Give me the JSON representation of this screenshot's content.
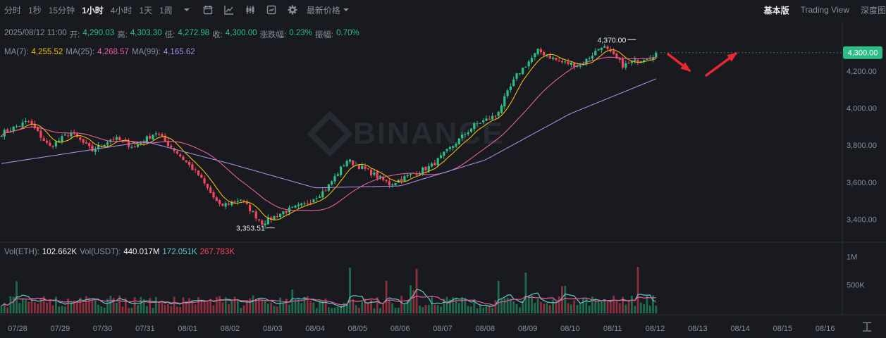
{
  "toolbar": {
    "intervals": [
      "分时",
      "1秒",
      "15分钟",
      "1小时",
      "4小时",
      "1天",
      "1周"
    ],
    "active_interval": "1小时",
    "price_mode": "最新价格",
    "views": [
      "基本版",
      "Trading View",
      "深度图"
    ],
    "active_view": "基本版"
  },
  "candle_info": {
    "datetime": "2025/08/12 11:00",
    "open_label": "开:",
    "open": "4,290.03",
    "high_label": "高:",
    "high": "4,303.30",
    "low_label": "低:",
    "low": "4,272.98",
    "close_label": "收:",
    "close": "4,300.00",
    "change_label": "涨跌幅:",
    "change": "0.23%",
    "amplitude_label": "振幅:",
    "amplitude": "0.70%"
  },
  "ma_info": {
    "ma7_label": "MA(7):",
    "ma7": "4,255.52",
    "ma25_label": "MA(25):",
    "ma25": "4,268.57",
    "ma99_label": "MA(99):",
    "ma99": "4,165.62"
  },
  "vol_info": {
    "vol_eth_label": "Vol(ETH):",
    "vol_eth": "102.662K",
    "vol_usdt_label": "Vol(USDT):",
    "vol_usdt": "440.017M",
    "ma_a": "172.051K",
    "ma_b": "267.783K"
  },
  "watermark": "BINANCE",
  "colors": {
    "up": "#2ebd85",
    "down": "#f6465d",
    "ma7": "#f0b90b",
    "ma25": "#e85d9a",
    "ma99": "#a88bde",
    "vol_ma_a": "#5fc9c9",
    "vol_ma_b": "#e85d9a",
    "arrow": "#e8272f",
    "background": "#181a20"
  },
  "chart_data": {
    "type": "candlestick",
    "interval": "1h",
    "x_tick_labels": [
      "07/28",
      "07/29",
      "07/30",
      "07/31",
      "08/01",
      "08/02",
      "08/03",
      "08/04",
      "08/05",
      "08/06",
      "08/07",
      "08/08",
      "08/09",
      "08/10",
      "08/11",
      "08/12",
      "08/13",
      "08/14",
      "08/15",
      "08/16"
    ],
    "price_axis_labels": [
      "4,200.00",
      "4,000.00",
      "3,800.00",
      "3,600.00",
      "3,400.00"
    ],
    "price_axis_values": [
      4200,
      4000,
      3800,
      3600,
      3400
    ],
    "price_range": [
      3280,
      4470
    ],
    "current_price": 4300,
    "current_price_label": "4,300.00",
    "high_marker": {
      "value": 4370,
      "label": "4,370.00",
      "date": "08/11"
    },
    "low_marker": {
      "value": 3353.51,
      "label": "3,353.51",
      "date": "08/03"
    },
    "volume_axis_labels": [
      "1M",
      "500K"
    ],
    "volume_axis_values": [
      1000000,
      500000
    ],
    "volume_range": [
      0,
      1180000
    ],
    "price_key_points": [
      {
        "date": "07/28",
        "close": 3860
      },
      {
        "date": "07/28",
        "close": 3930
      },
      {
        "date": "07/29",
        "close": 3790
      },
      {
        "date": "07/29",
        "close": 3870
      },
      {
        "date": "07/30",
        "close": 3770
      },
      {
        "date": "07/30",
        "close": 3840
      },
      {
        "date": "07/31",
        "close": 3790
      },
      {
        "date": "07/31",
        "close": 3870
      },
      {
        "date": "08/01",
        "close": 3760
      },
      {
        "date": "08/01",
        "close": 3640
      },
      {
        "date": "08/02",
        "close": 3470
      },
      {
        "date": "08/02",
        "close": 3510
      },
      {
        "date": "08/03",
        "close": 3380
      },
      {
        "date": "08/03",
        "close": 3440
      },
      {
        "date": "08/04",
        "close": 3480
      },
      {
        "date": "08/04",
        "close": 3560
      },
      {
        "date": "08/05",
        "close": 3720
      },
      {
        "date": "08/05",
        "close": 3660
      },
      {
        "date": "08/06",
        "close": 3590
      },
      {
        "date": "08/06",
        "close": 3640
      },
      {
        "date": "08/07",
        "close": 3690
      },
      {
        "date": "08/07",
        "close": 3800
      },
      {
        "date": "08/08",
        "close": 3910
      },
      {
        "date": "08/08",
        "close": 3960
      },
      {
        "date": "08/09",
        "close": 4180
      },
      {
        "date": "08/09",
        "close": 4310
      },
      {
        "date": "08/10",
        "close": 4250
      },
      {
        "date": "08/10",
        "close": 4230
      },
      {
        "date": "08/11",
        "close": 4340
      },
      {
        "date": "08/11",
        "close": 4230
      },
      {
        "date": "08/12",
        "close": 4300
      }
    ],
    "ma99_key_points": [
      {
        "date": "07/28",
        "value": 3700
      },
      {
        "date": "07/31",
        "value": 3820
      },
      {
        "date": "08/02",
        "value": 3700
      },
      {
        "date": "08/04",
        "value": 3570
      },
      {
        "date": "08/06",
        "value": 3580
      },
      {
        "date": "08/08",
        "value": 3720
      },
      {
        "date": "08/10",
        "value": 3970
      },
      {
        "date": "08/12",
        "value": 4165
      }
    ],
    "series": [
      {
        "name": "MA(7)",
        "last": 4255.52
      },
      {
        "name": "MA(25)",
        "last": 4268.57
      },
      {
        "name": "MA(99)",
        "last": 4165.62
      }
    ]
  }
}
